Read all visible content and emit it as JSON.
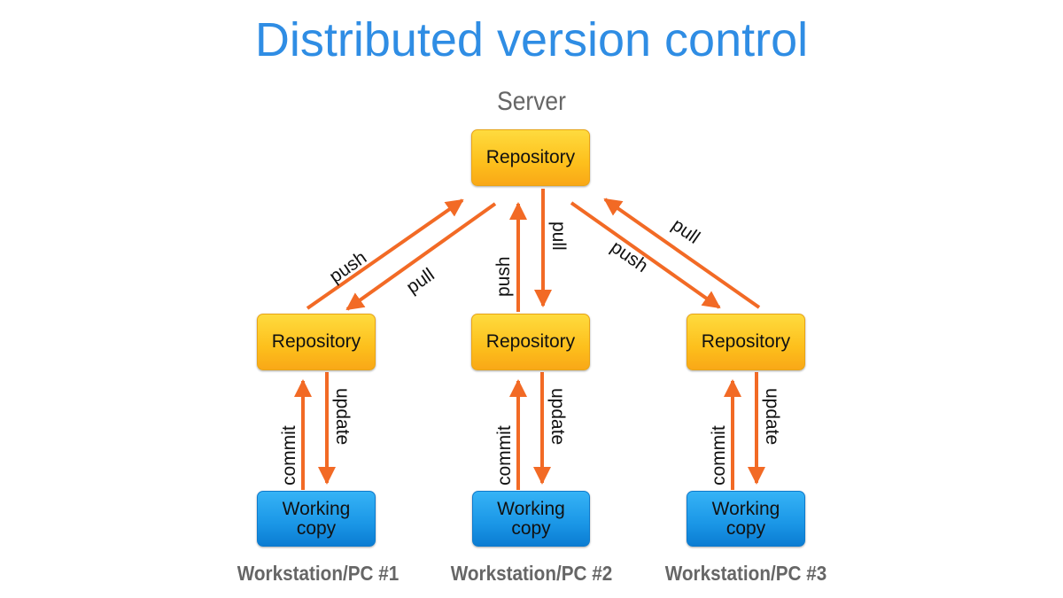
{
  "title": "Distributed version control",
  "server": {
    "label": "Server",
    "repository_label": "Repository"
  },
  "workstations": [
    {
      "label": "Workstation/PC #1",
      "repository_label": "Repository",
      "working_copy_label": [
        "Working",
        "copy"
      ]
    },
    {
      "label": "Workstation/PC #2",
      "repository_label": "Repository",
      "working_copy_label": [
        "Working",
        "copy"
      ]
    },
    {
      "label": "Workstation/PC #3",
      "repository_label": "Repository",
      "working_copy_label": [
        "Working",
        "copy"
      ]
    }
  ],
  "arrow_labels": {
    "push": "push",
    "pull": "pull",
    "commit": "commit",
    "update": "update"
  },
  "colors": {
    "title": "#2f8de4",
    "arrow": "#f26a25",
    "repository": "#fdbf1c",
    "working_copy": "#1a96e6",
    "label_gray": "#666666"
  }
}
